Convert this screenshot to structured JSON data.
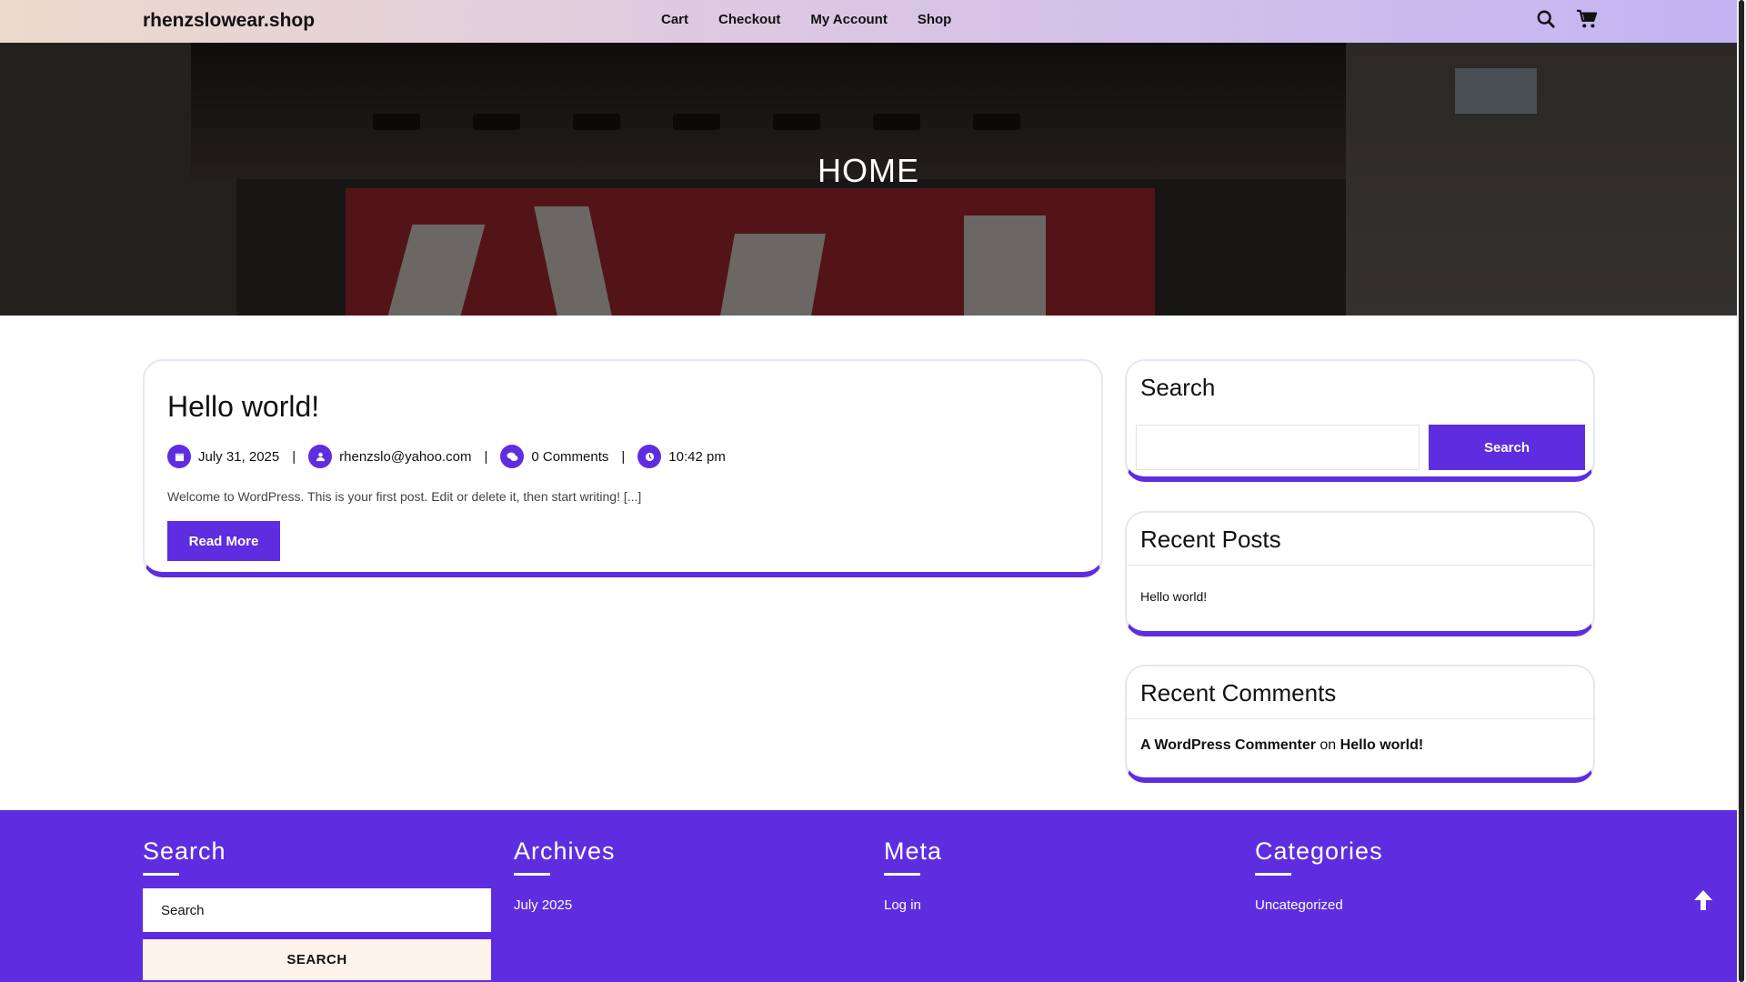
{
  "header": {
    "brand": "rhenzslowear.shop",
    "nav": [
      "Cart",
      "Checkout",
      "My Account",
      "Shop"
    ],
    "icons": [
      "search-icon",
      "cart-icon"
    ]
  },
  "hero": {
    "title": "HOME"
  },
  "post": {
    "title": "Hello world!",
    "date": "July 31, 2025",
    "author": "rhenzslo@yahoo.com",
    "comments": "0 Comments",
    "time": "10:42 pm",
    "separator": "|",
    "excerpt": "Welcome to WordPress. This is your first post. Edit or delete it, then start writing! [...]",
    "read_more": "Read More"
  },
  "sidebar": {
    "search": {
      "title": "Search",
      "button": "Search",
      "placeholder": ""
    },
    "recent_posts": {
      "title": "Recent Posts",
      "items": [
        "Hello world!"
      ]
    },
    "recent_comments": {
      "title": "Recent Comments",
      "author": "A WordPress Commenter",
      "on": "on",
      "post": "Hello world!"
    }
  },
  "footer": {
    "search": {
      "title": "Search",
      "placeholder": "Search",
      "button": "SEARCH"
    },
    "archives": {
      "title": "Archives",
      "items": [
        "July 2025"
      ]
    },
    "meta": {
      "title": "Meta",
      "items": [
        "Log in"
      ]
    },
    "categories": {
      "title": "Categories",
      "items": [
        "Uncategorized"
      ]
    }
  },
  "colors": {
    "accent": "#5e2de0",
    "footer_button_bg": "#fdf3ea",
    "card_border": "#e3e8f5"
  }
}
